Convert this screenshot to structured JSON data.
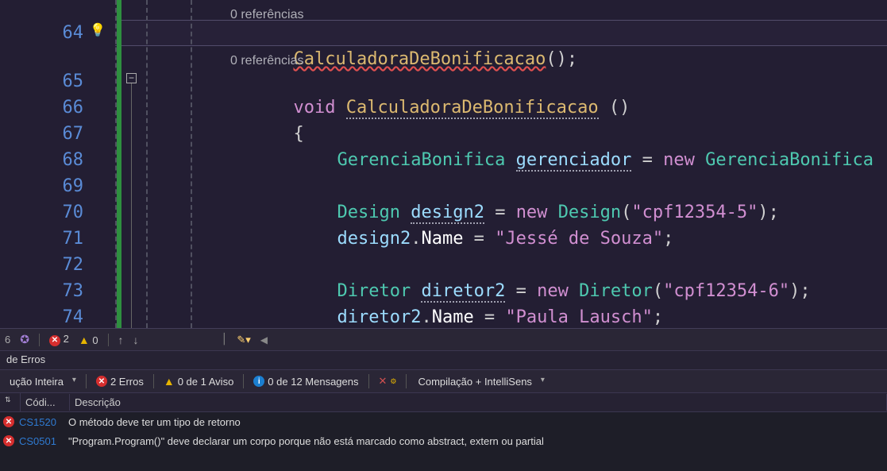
{
  "editor": {
    "ref_label_top": "0 referências",
    "ref_label_mid": "0 referências",
    "lines": [
      {
        "n": 64
      },
      {
        "n": 65
      },
      {
        "n": 66
      },
      {
        "n": 67
      },
      {
        "n": 68
      },
      {
        "n": 69
      },
      {
        "n": 70
      },
      {
        "n": 71
      },
      {
        "n": 72
      },
      {
        "n": 73
      },
      {
        "n": 74
      }
    ],
    "code": {
      "l64_call": "CalculadoraDeBonificacao",
      "l64_after": "();",
      "l65_void": "void",
      "l65_name": "CalculadoraDeBonificacao",
      "l65_paren": " ()",
      "l66_brace": "{",
      "l67_type": "GerenciaBonifica",
      "l67_var": "gerenciador",
      "l67_eq": "=",
      "l67_new": "new",
      "l67_ctor": "GerenciaBonifica",
      "l67_tail": " ()",
      "l69_type": "Design",
      "l69_var": "design2",
      "l69_eq": "=",
      "l69_new": "new",
      "l69_ctor": "Design",
      "l69_args_open": "(",
      "l69_str": "\"cpf12354-5\"",
      "l69_args_close": ");",
      "l70_obj": "design2",
      "l70_dot": ".",
      "l70_prop": "Name",
      "l70_eq": " = ",
      "l70_str": "\"Jessé de Souza\"",
      "l70_end": ";",
      "l72_type": "Diretor",
      "l72_var": "diretor2",
      "l72_eq": "=",
      "l72_new": "new",
      "l72_ctor": "Diretor",
      "l72_args_open": "(",
      "l72_str": "\"cpf12354-6\"",
      "l72_args_close": ");",
      "l73_obj": "diretor2",
      "l73_dot": ".",
      "l73_prop": "Name",
      "l73_eq": " = ",
      "l73_str": "\"Paula Lausch\"",
      "l73_end": ";"
    }
  },
  "status": {
    "left_num": "6",
    "errors": "2",
    "warnings": "0"
  },
  "panel": {
    "title": "de Erros",
    "scope": "ução Inteira",
    "err_btn": "2 Erros",
    "warn_btn": "0 de 1 Aviso",
    "msg_btn": "0 de 12 Mensagens",
    "mode": "Compilação + IntelliSens",
    "col_code": "Códi...",
    "col_desc": "Descrição",
    "rows": [
      {
        "code": "CS1520",
        "desc": "O método deve ter um tipo de retorno"
      },
      {
        "code": "CS0501",
        "desc": "\"Program.Program()\" deve declarar um corpo porque não está marcado como abstract, extern ou partial"
      }
    ]
  }
}
